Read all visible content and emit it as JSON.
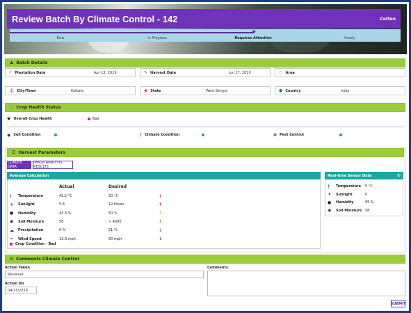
{
  "header": {
    "title": "Review Batch By Climate Control - 142",
    "crop": "Cotton"
  },
  "progress": {
    "steps": [
      "New",
      "In Progress",
      "Requires Attention",
      "Ready"
    ],
    "active_index": 2
  },
  "batch_details": {
    "heading": "Batch Details",
    "plantation_label": "Plantation Date",
    "plantation_value": "Apr 13, 2019",
    "harvest_label": "Harvest Date",
    "harvest_value": "Jun 27, 2019",
    "area_label": "Area",
    "area_value": "",
    "city_label": "City/Town",
    "city_value": "Kolkata",
    "state_label": "State",
    "state_value": "West Bengal",
    "country_label": "Country",
    "country_value": "India"
  },
  "crop_health": {
    "heading": "Crop Health Status",
    "overall_label": "Overall Crop Health",
    "overall_value": "Bad",
    "overall_color": "#d6195f",
    "soil_label": "Soil Condition",
    "soil_color": "#20b020",
    "climate_label": "Climate Condition",
    "climate_color": "#20b020",
    "pest_label": "Pest Control",
    "pest_color": "#20b020"
  },
  "harvest": {
    "heading": "Harvest Parameters",
    "tab_climate": "CLIMATE DATA",
    "tab_image": "IMAGE ANALYSIS RESULTS",
    "avg_heading": "Average Calculation",
    "col_actual": "Actual",
    "col_desired": "Desired",
    "rows": [
      {
        "name": "Temperature",
        "actual": "42.5 °C",
        "desired": "20 °C",
        "trend": "up",
        "trend_color": "#d6195f"
      },
      {
        "name": "Sunlight",
        "actual": "5.8",
        "desired": "12 Hours",
        "trend": "up",
        "trend_color": "#d6195f"
      },
      {
        "name": "Humidity",
        "actual": "43.3 %",
        "desired": "50 %",
        "trend": "up",
        "trend_color": "#f0b400"
      },
      {
        "name": "Soil Moisture",
        "actual": "58",
        "desired": "< 4000",
        "trend": "down",
        "trend_color": "#20b020"
      },
      {
        "name": "Precipitation",
        "actual": "0 %",
        "desired": "51 %",
        "trend": "down",
        "trend_color": "#20b020"
      },
      {
        "name": "Wind Speed",
        "actual": "13.3 mph",
        "desired": "60 mph",
        "trend": "down",
        "trend_color": "#d6195f"
      }
    ],
    "crop_condition": "Crop Condition - Bad",
    "rt_heading": "Real-time Sensor Data",
    "rt_rows": [
      {
        "name": "Temperature",
        "value": "5 °C"
      },
      {
        "name": "Sunlight",
        "value": "0"
      },
      {
        "name": "Humidity",
        "value": "95 %"
      },
      {
        "name": "Soil Moisture",
        "value": "58"
      }
    ]
  },
  "comments": {
    "heading": "Comments  Climate Control",
    "action_taken_label": "Action Taken",
    "action_taken_value": "Resolved",
    "action_on_label": "Action On",
    "action_on_value": "04/15/2019",
    "comments_label": "Comments",
    "comments_value": "",
    "submit_label": "SUBMIT"
  }
}
